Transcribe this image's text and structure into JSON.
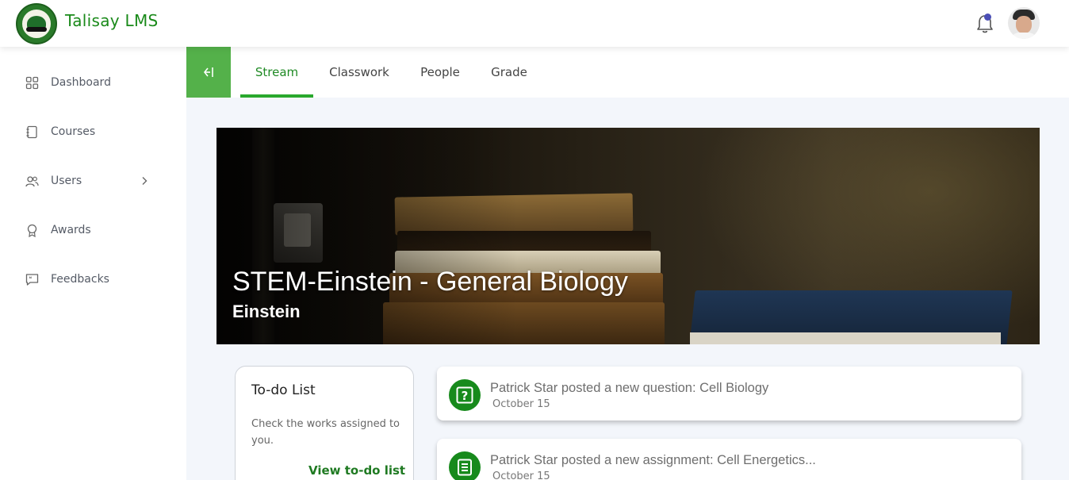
{
  "app": {
    "title": "Talisay LMS"
  },
  "header": {
    "notification_icon": "bell-icon",
    "avatar": "user-avatar"
  },
  "sidebar": {
    "items": [
      {
        "label": "Dashboard",
        "icon": "grid-icon"
      },
      {
        "label": "Courses",
        "icon": "book-icon"
      },
      {
        "label": "Users",
        "icon": "users-icon",
        "has_submenu": true
      },
      {
        "label": "Awards",
        "icon": "award-icon"
      },
      {
        "label": "Feedbacks",
        "icon": "message-icon"
      }
    ]
  },
  "tabs": [
    {
      "label": "Stream",
      "active": true
    },
    {
      "label": "Classwork",
      "active": false
    },
    {
      "label": "People",
      "active": false
    },
    {
      "label": "Grade",
      "active": false
    }
  ],
  "banner": {
    "title": "STEM-Einstein - General Biology",
    "subtitle": "Einstein"
  },
  "todo": {
    "title": "To-do List",
    "description": "Check the works assigned to you.",
    "link": "View to-do list"
  },
  "posts": [
    {
      "title": "Patrick Star posted a new question: Cell Biology",
      "date": "October 15",
      "icon": "question-icon"
    },
    {
      "title": "Patrick Star posted a new assignment: Cell Energetics...",
      "date": "October 15",
      "icon": "assignment-icon"
    }
  ],
  "colors": {
    "brand_green": "#1a8a1a",
    "accent_green": "#29a82d",
    "collapse_green": "#54b14a",
    "main_bg": "#f3f6fb"
  }
}
